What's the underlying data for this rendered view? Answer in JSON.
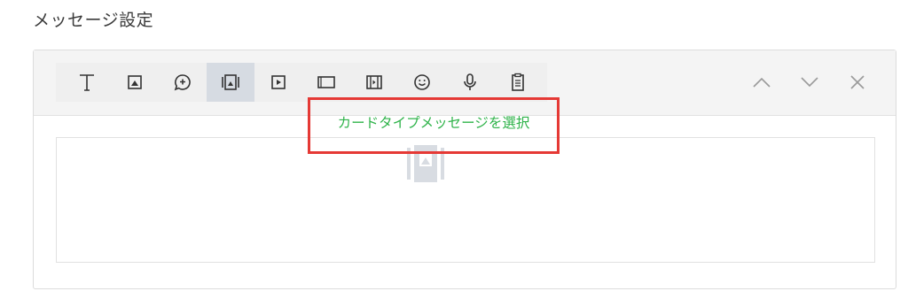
{
  "page": {
    "title": "メッセージ設定"
  },
  "toolbar": {
    "tools": [
      {
        "icon": "text-icon"
      },
      {
        "icon": "image-icon"
      },
      {
        "icon": "add-balloon-icon"
      },
      {
        "icon": "card-message-icon",
        "active": true
      },
      {
        "icon": "video-icon"
      },
      {
        "icon": "rich-message-icon"
      },
      {
        "icon": "rich-video-icon"
      },
      {
        "icon": "emoji-icon"
      },
      {
        "icon": "microphone-icon"
      },
      {
        "icon": "clipboard-icon"
      }
    ],
    "nav": [
      {
        "icon": "chevron-up-icon"
      },
      {
        "icon": "chevron-down-icon"
      },
      {
        "icon": "close-icon"
      }
    ]
  },
  "content": {
    "select_card_label": "カードタイプメッセージを選択",
    "highlight_color": "#e53935",
    "link_color": "#2fb34a"
  }
}
